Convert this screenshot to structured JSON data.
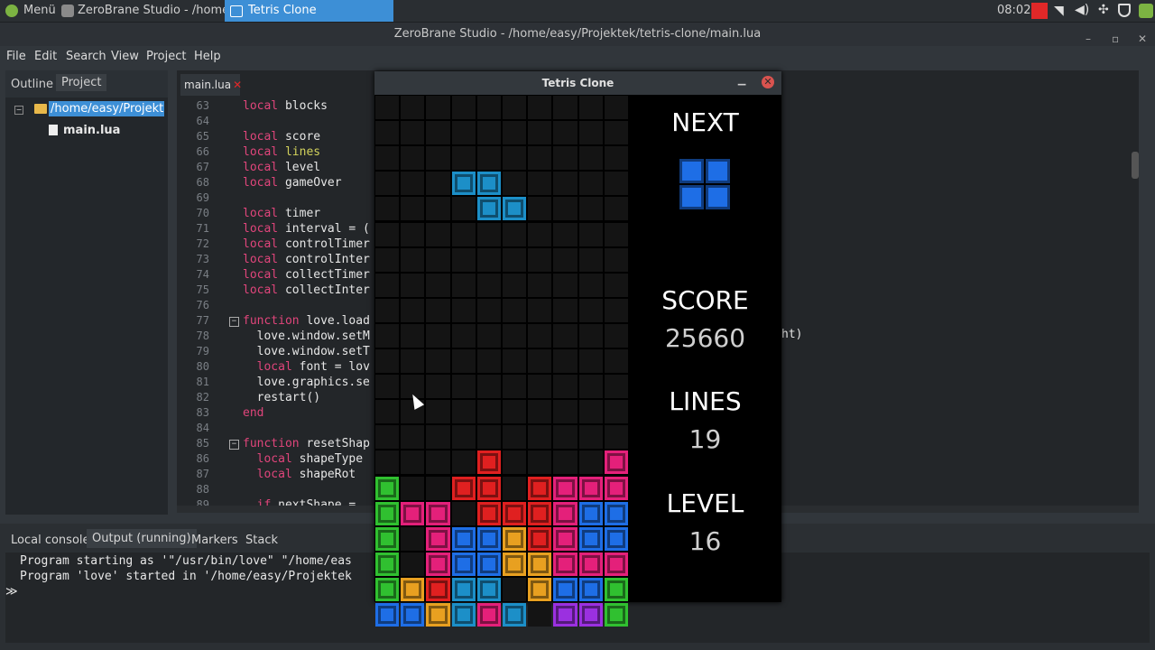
{
  "taskbar": {
    "menu_label": "Menü",
    "zb_task_label": "ZeroBrane Studio - /home...",
    "tetris_task_label": "Tetris Clone",
    "clock": "08:02"
  },
  "window": {
    "title": "ZeroBrane Studio - /home/easy/Projektek/tetris-clone/main.lua"
  },
  "menubar": [
    "File",
    "Edit",
    "Search",
    "View",
    "Project",
    "Help"
  ],
  "left_panel": {
    "tabs": [
      "Outline",
      "Project"
    ],
    "tree": {
      "folder": "/home/easy/Projektek",
      "file": "main.lua"
    }
  },
  "editor": {
    "tab_label": "main.lua",
    "lines": [
      {
        "n": "63",
        "code": "local blocks"
      },
      {
        "n": "64",
        "code": ""
      },
      {
        "n": "65",
        "code": "local score"
      },
      {
        "n": "66",
        "code": "local lines"
      },
      {
        "n": "67",
        "code": "local level"
      },
      {
        "n": "68",
        "code": "local gameOver"
      },
      {
        "n": "69",
        "code": ""
      },
      {
        "n": "70",
        "code": "local timer"
      },
      {
        "n": "71",
        "code": "local interval = ("
      },
      {
        "n": "72",
        "code": "local controlTimer"
      },
      {
        "n": "73",
        "code": "local controlInter"
      },
      {
        "n": "74",
        "code": "local collectTimer"
      },
      {
        "n": "75",
        "code": "local collectInter"
      },
      {
        "n": "76",
        "code": ""
      },
      {
        "n": "77",
        "code": "function love.load"
      },
      {
        "n": "78",
        "code": "  love.window.setM"
      },
      {
        "n": "79",
        "code": "  love.window.setT"
      },
      {
        "n": "80",
        "code": "  local font = lov"
      },
      {
        "n": "81",
        "code": "  love.graphics.se"
      },
      {
        "n": "82",
        "code": "  restart()"
      },
      {
        "n": "83",
        "code": "end"
      },
      {
        "n": "84",
        "code": ""
      },
      {
        "n": "85",
        "code": "function resetShap"
      },
      {
        "n": "86",
        "code": "  local shapeType"
      },
      {
        "n": "87",
        "code": "  local shapeRot"
      },
      {
        "n": "88",
        "code": ""
      },
      {
        "n": "89",
        "code": "  if nextShape = "
      }
    ],
    "overflow_text": "ht)"
  },
  "bottom_panel": {
    "tabs": [
      "Local console",
      "Output (running)",
      "Markers",
      "Stack"
    ],
    "console_lines": [
      "Program starting as '\"/usr/bin/love\" \"/home/eas",
      "Program 'love' started in '/home/easy/Projektek"
    ],
    "prompt": "≫"
  },
  "game": {
    "title": "Tetris Clone",
    "next_label": "NEXT",
    "score_label": "SCORE",
    "score": "25660",
    "lines_label": "LINES",
    "lines": "19",
    "level_label": "LEVEL",
    "level": "16",
    "colors": {
      "I": "#1e6ee6",
      "J": "#1c8fc8",
      "L": "#e8a020",
      "O": "#e4207a",
      "S": "#e02020",
      "T": "#9b30e0",
      "Z": "#30c030"
    },
    "board": [
      "..........",
      "..........",
      "..........",
      "...JJ.....",
      "....JJ....",
      "..........",
      "..........",
      "..........",
      "..........",
      "..........",
      "..........",
      "..........",
      "..........",
      "..........",
      "....S....O",
      "Z..SS.SOOO",
      "ZOO.SSSOII",
      "Z.OIILSOII",
      "Z.OIILLOOO",
      "ZLSJJ.LIIZ",
      "IILJOJ.TTZ"
    ],
    "next_piece": [
      "II",
      "II"
    ],
    "next_color": "#1e6ee6"
  }
}
